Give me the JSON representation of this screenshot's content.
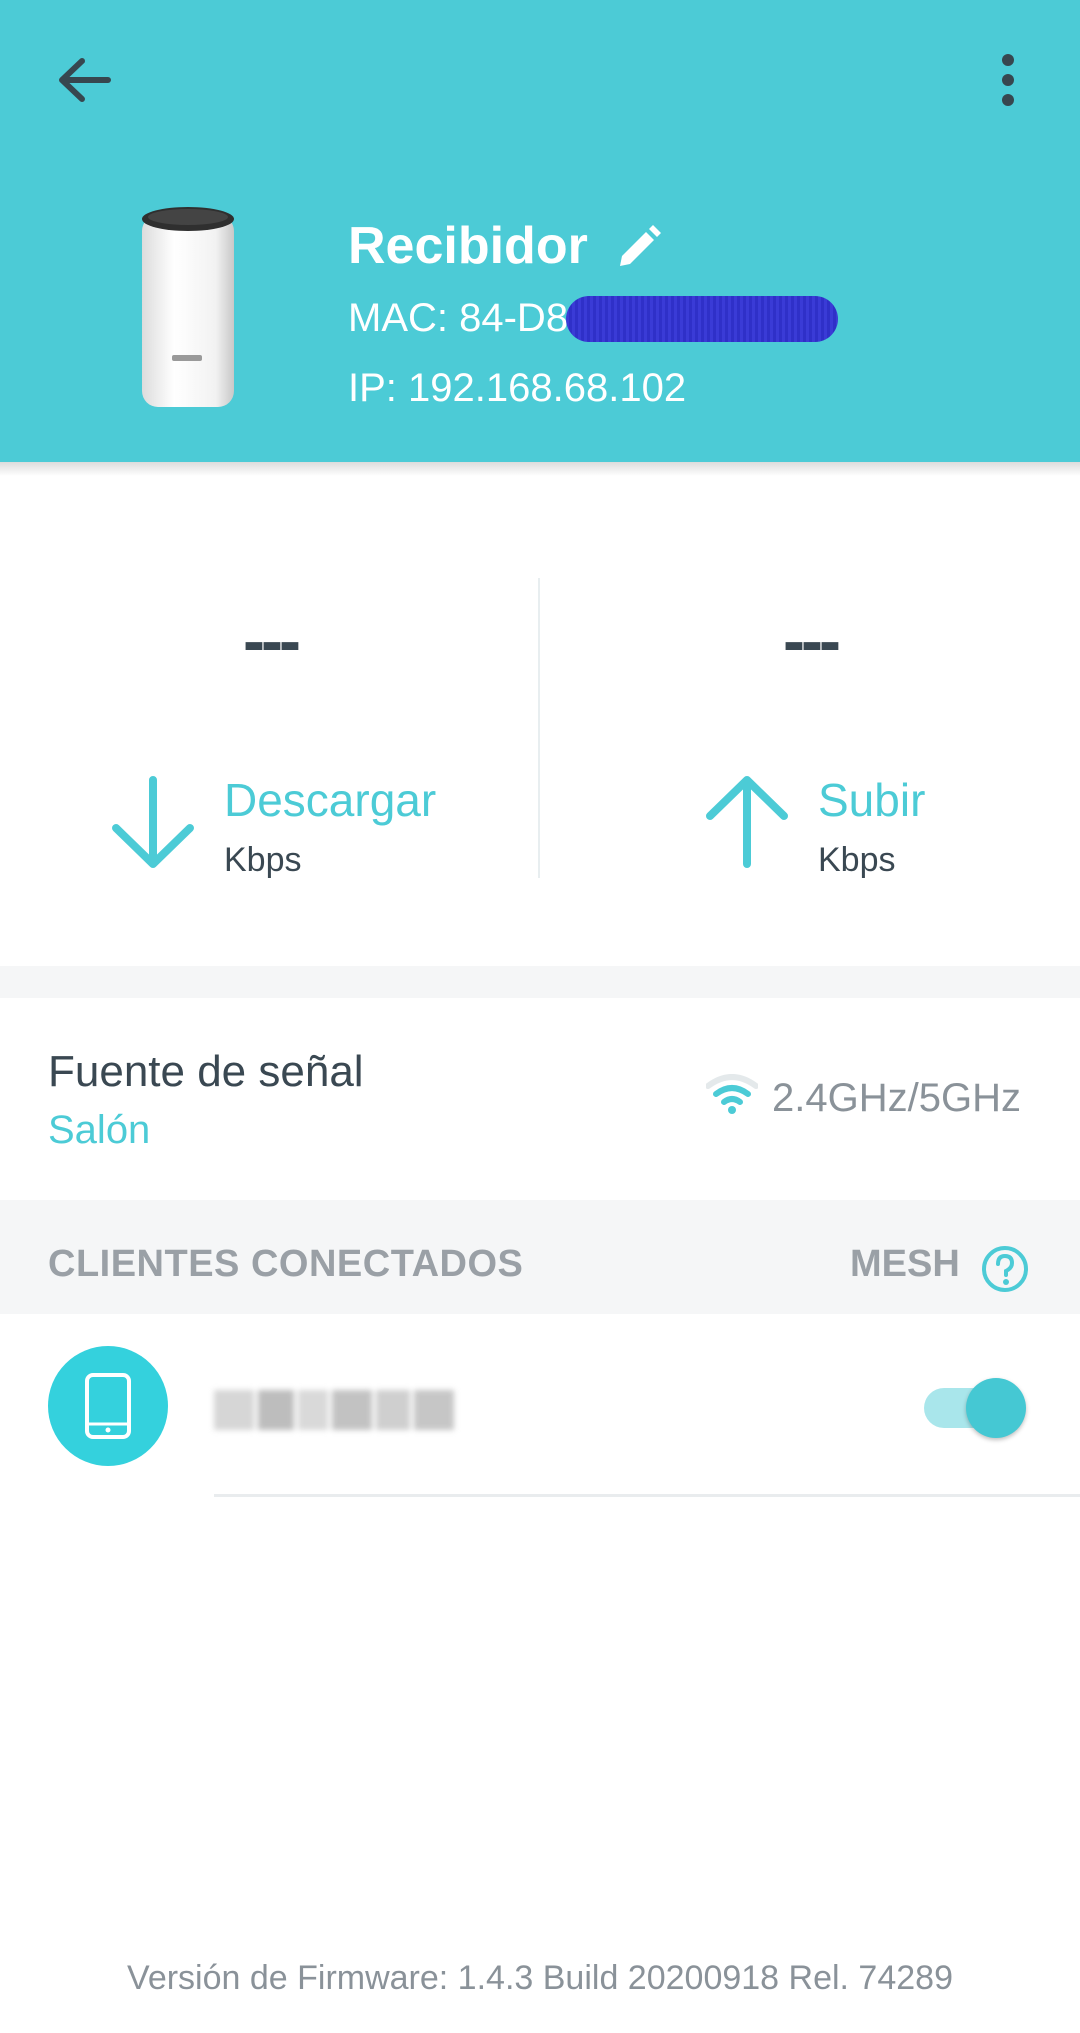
{
  "header": {
    "device_name": "Recibidor",
    "mac_label": "MAC: 84-D8",
    "ip_label": "IP: 192.168.68.102",
    "background_color": "#4ccbd6",
    "icons": [
      "back-arrow-icon",
      "more-vertical-icon",
      "edit-pencil-icon"
    ]
  },
  "speed": {
    "download": {
      "value": "---",
      "label": "Descargar",
      "unit": "Kbps"
    },
    "upload": {
      "value": "---",
      "label": "Subir",
      "unit": "Kbps"
    },
    "accent_color": "#4ccbd6"
  },
  "signal_source": {
    "title": "Fuente de señal",
    "value": "Salón",
    "band": "2.4GHz/5GHz"
  },
  "clients": {
    "section_title": "CLIENTES CONECTADOS",
    "mesh_label": "MESH",
    "items": [
      {
        "icon": "smartphone-icon",
        "toggle_on": true
      }
    ]
  },
  "footer": {
    "firmware": "Versión de Firmware: 1.4.3 Build 20200918 Rel. 74289"
  }
}
